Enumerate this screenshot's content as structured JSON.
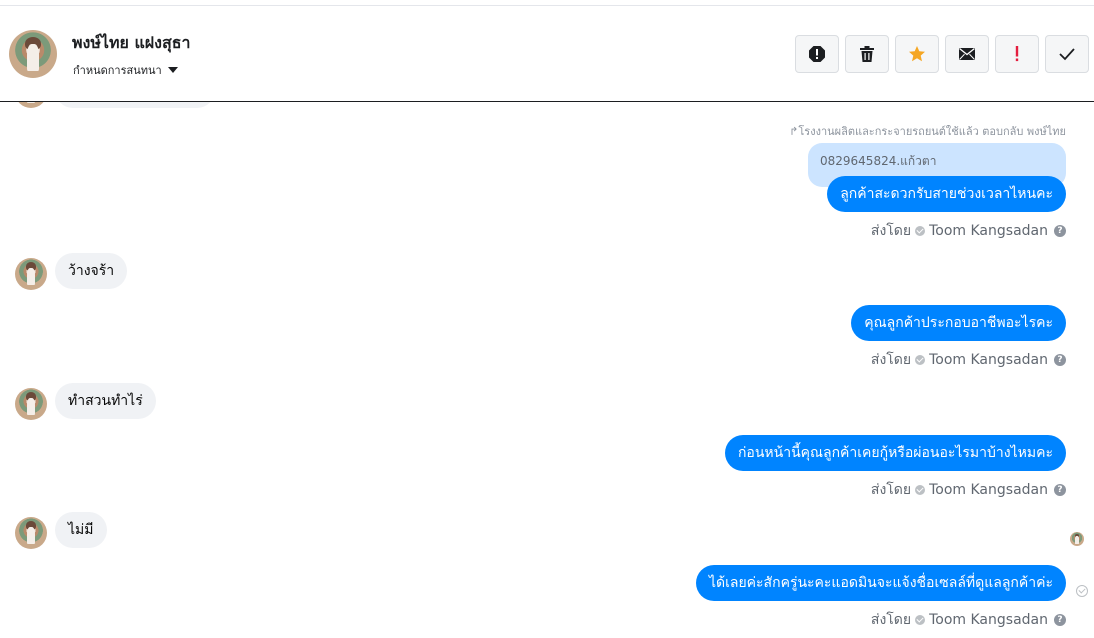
{
  "conversation": {
    "name": "พงษ์ไทย แฝงสุธา",
    "subtitle": "กำหนดการสนทนา"
  },
  "toolbar": {
    "buttons": [
      {
        "name": "report-icon",
        "color": "#1c1e21"
      },
      {
        "name": "trash-icon",
        "color": "#1c1e21"
      },
      {
        "name": "star-icon",
        "color": "#f5a623"
      },
      {
        "name": "envelope-icon",
        "color": "#1c1e21"
      },
      {
        "name": "important-icon",
        "color": "#e41e3f"
      },
      {
        "name": "check-icon",
        "color": "#1c1e21"
      }
    ]
  },
  "reply": {
    "note": "โรงงานผลิตและกระจายรถยนต์ใช้แล้ว ตอบกลับ พงษ์ไทย",
    "quoted_text": "0829645824.แก้วตา"
  },
  "messages": [
    {
      "direction": "out",
      "text": "ลูกค้าสะดวกรับสายช่วงเวลาไหนคะ",
      "sent_by_label": "ส่งโดย",
      "sender": "Toom Kangsadan"
    },
    {
      "direction": "in",
      "text": "ว้างจร้า"
    },
    {
      "direction": "out",
      "text": "คุณลูกค้าประกอบอาชีพอะไรคะ",
      "sent_by_label": "ส่งโดย",
      "sender": "Toom Kangsadan"
    },
    {
      "direction": "in",
      "text": "ทำสวนทำไร่"
    },
    {
      "direction": "out",
      "text": "ก่อนหน้านี้คุณลูกค้าเคยกู้หรือผ่อนอะไรมาบ้างไหมคะ",
      "sent_by_label": "ส่งโดย",
      "sender": "Toom Kangsadan"
    },
    {
      "direction": "in",
      "text": "ไม่มี"
    },
    {
      "direction": "out",
      "text": "ได้เลยค่ะสักครู่นะคะแอดมินจะแจ้งชื่อเซลล์ที่ดูแลลูกค้าค่ะ",
      "sent_by_label": "ส่งโดย",
      "sender": "Toom Kangsadan"
    }
  ]
}
